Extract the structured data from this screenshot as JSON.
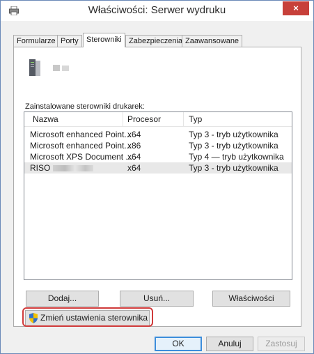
{
  "window": {
    "title": "Właściwości: Serwer wydruku",
    "close_label": "×"
  },
  "tabs": [
    {
      "label": "Formularze",
      "active": false
    },
    {
      "label": "Porty",
      "active": false
    },
    {
      "label": "Sterowniki",
      "active": true
    },
    {
      "label": "Zabezpieczenia",
      "active": false
    },
    {
      "label": "Zaawansowane",
      "active": false
    }
  ],
  "drivers": {
    "list_label": "Zainstalowane sterowniki drukarek:",
    "columns": [
      "Nazwa",
      "Procesor",
      "Typ"
    ],
    "rows": [
      {
        "name": "Microsoft enhanced Point...",
        "processor": "x64",
        "type": "Typ 3 - tryb użytkownika",
        "selected": false
      },
      {
        "name": "Microsoft enhanced Point...",
        "processor": "x86",
        "type": "Typ 3 - tryb użytkownika",
        "selected": false
      },
      {
        "name": "Microsoft XPS Document ...",
        "processor": "x64",
        "type": "Typ 4 — tryb użytkownika",
        "selected": false
      },
      {
        "name": "RISO",
        "processor": "x64",
        "type": "Typ 3 - tryb użytkownika",
        "selected": true
      }
    ]
  },
  "buttons": {
    "add": "Dodaj...",
    "remove": "Usuń...",
    "properties": "Właściwości",
    "change_settings": "Zmień ustawienia sterownika",
    "ok": "OK",
    "cancel": "Anuluj",
    "apply": "Zastosuj"
  },
  "colors": {
    "highlight": "#d03a3a",
    "close_button": "#c7403a",
    "default_button_border": "#3c8ddb"
  }
}
